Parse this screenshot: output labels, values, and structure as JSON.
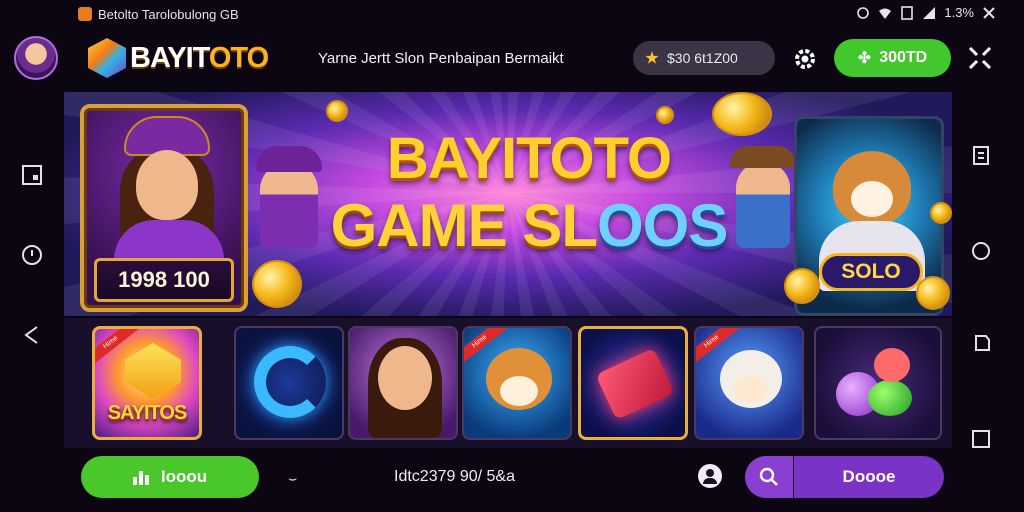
{
  "statusbar": {
    "notification": "Betolto Tarolobulong GB",
    "indicators": "1.3%"
  },
  "header": {
    "logo_text_prefix": "BAYIT",
    "logo_text_suffix": "OTO",
    "tagline": "Yarne Jertt Slon Penbaipan Bermaikt",
    "balance": "$30 6t1Z00",
    "deposit_label": "300TD"
  },
  "banner": {
    "title_line1": "BAYITOTO",
    "title_line2_part1": "GAME SL",
    "title_line2_part2": "OOS",
    "left_plaque": "1998 100",
    "right_badge": "SOLO"
  },
  "tiles": [
    {
      "name": "sayitos",
      "label": "SAYITOS",
      "ribbon": "Hime"
    },
    {
      "name": "blue-ring",
      "label": ""
    },
    {
      "name": "lady",
      "label": ""
    },
    {
      "name": "fox",
      "label": "",
      "ribbon": "Hime"
    },
    {
      "name": "red-gem",
      "label": ""
    },
    {
      "name": "bear",
      "label": "",
      "ribbon": "Hime"
    },
    {
      "name": "potions",
      "label": ""
    }
  ],
  "bottombar": {
    "play_label": "Iooou",
    "info_text": "Idtc2379 90/ 5&a",
    "more_label": "Doooe"
  },
  "colors": {
    "accent_green": "#42c72c",
    "accent_purple": "#7a33c4",
    "gold": "#ffcf2e"
  }
}
